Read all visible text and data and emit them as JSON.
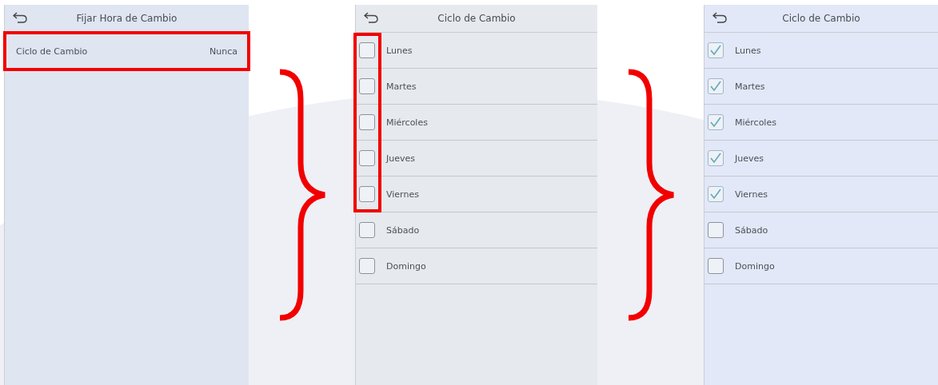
{
  "screens": [
    {
      "title": "Fijar Hora de Cambio",
      "kind": "settings",
      "rows": [
        {
          "label": "Ciclo de Cambio",
          "value": "Nunca",
          "highlighted": true
        }
      ]
    },
    {
      "title": "Ciclo de Cambio",
      "kind": "checklist",
      "days": [
        {
          "label": "Lunes",
          "checked": false,
          "highlighted": true
        },
        {
          "label": "Martes",
          "checked": false,
          "highlighted": true
        },
        {
          "label": "Miércoles",
          "checked": false,
          "highlighted": true
        },
        {
          "label": "Jueves",
          "checked": false,
          "highlighted": true
        },
        {
          "label": "Viernes",
          "checked": false,
          "highlighted": true
        },
        {
          "label": "Sábado",
          "checked": false,
          "highlighted": false
        },
        {
          "label": "Domingo",
          "checked": false,
          "highlighted": false
        }
      ]
    },
    {
      "title": "Ciclo de Cambio",
      "kind": "checklist",
      "days": [
        {
          "label": "Lunes",
          "checked": true
        },
        {
          "label": "Martes",
          "checked": true
        },
        {
          "label": "Miércoles",
          "checked": true
        },
        {
          "label": "Jueves",
          "checked": true
        },
        {
          "label": "Viernes",
          "checked": true
        },
        {
          "label": "Sábado",
          "checked": false
        },
        {
          "label": "Domingo",
          "checked": false
        }
      ]
    }
  ]
}
